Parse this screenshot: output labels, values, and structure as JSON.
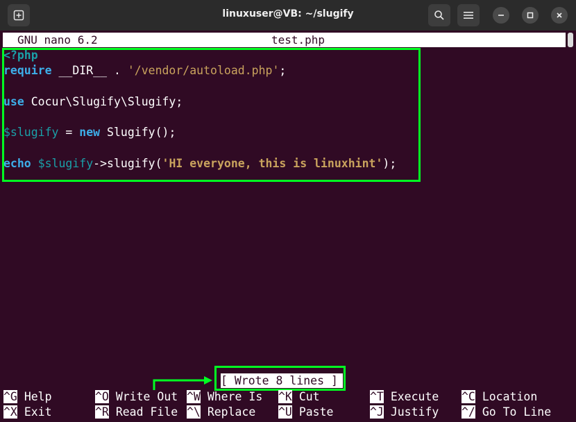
{
  "window": {
    "title": "linuxuser@VB: ~/slugify"
  },
  "icons": {
    "new_tab": "new-tab-icon",
    "search": "search-icon",
    "menu": "hamburger-icon",
    "minimize": "minimize-icon",
    "maximize": "maximize-icon",
    "close": "close-icon"
  },
  "nano": {
    "version": "GNU nano 6.2",
    "filename": "test.php"
  },
  "code": {
    "line1": "<?php",
    "line2_kw": "require",
    "line2_const": " __DIR__ . ",
    "line2_str": "'/vendor/autoload.php'",
    "line2_end": ";",
    "line3_kw": "use",
    "line3_rest": " Cocur\\Slugify\\Slugify;",
    "line4_var": "$slugify",
    "line4_op": " = ",
    "line4_kw": "new",
    "line4_rest": " Slugify();",
    "line5_kw": "echo",
    "line5_sp": " ",
    "line5_var": "$slugify",
    "line5_mid": "->slugify(",
    "line5_str": "'HI everyone, this is linuxhint'",
    "line5_end": ");"
  },
  "status": "[ Wrote 8 lines ]",
  "shortcuts": [
    {
      "key": "^G",
      "label": "Help"
    },
    {
      "key": "^O",
      "label": "Write Out"
    },
    {
      "key": "^W",
      "label": "Where Is"
    },
    {
      "key": "^K",
      "label": "Cut"
    },
    {
      "key": "^T",
      "label": "Execute"
    },
    {
      "key": "^C",
      "label": "Location"
    },
    {
      "key": "^X",
      "label": "Exit"
    },
    {
      "key": "^R",
      "label": "Read File"
    },
    {
      "key": "^\\",
      "label": "Replace"
    },
    {
      "key": "^U",
      "label": "Paste"
    },
    {
      "key": "^J",
      "label": "Justify"
    },
    {
      "key": "^/",
      "label": "Go To Line"
    }
  ],
  "colors": {
    "background": "#300a24",
    "highlight": "#00ff22",
    "keyword": "#3daee9",
    "string": "#c9a35d"
  }
}
